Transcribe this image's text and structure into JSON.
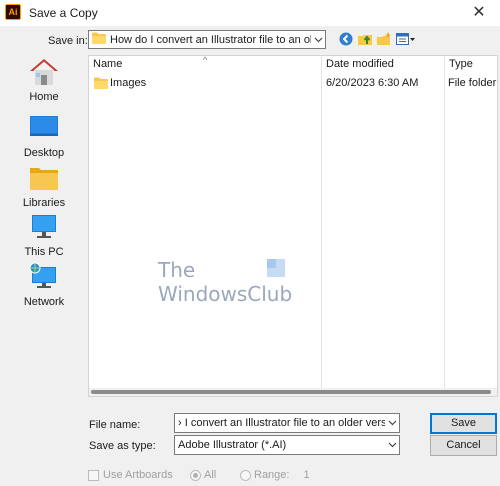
{
  "window": {
    "app_icon_text": "Ai",
    "title": "Save a Copy",
    "close_glyph": "✕"
  },
  "save_in": {
    "label": "Save in:",
    "value": "How do I convert an Illustrator file to an older version",
    "icon": "folder-icon"
  },
  "toolbar": {
    "icons": [
      "back-icon",
      "up-folder-icon",
      "new-folder-icon",
      "view-menu-icon"
    ]
  },
  "places": [
    {
      "label": "Home",
      "icon": "home-icon"
    },
    {
      "label": "Desktop",
      "icon": "desktop-icon"
    },
    {
      "label": "Libraries",
      "icon": "libraries-icon"
    },
    {
      "label": "This PC",
      "icon": "this-pc-icon"
    },
    {
      "label": "Network",
      "icon": "network-icon"
    }
  ],
  "file_list": {
    "columns": [
      "Name",
      "Date modified",
      "Type"
    ],
    "sort_indicator": "^",
    "rows": [
      {
        "name": "Images",
        "date": "6/20/2023 6:30 AM",
        "type": "File folder",
        "icon": "folder-icon"
      }
    ]
  },
  "watermark": {
    "line1": "The",
    "line2": "WindowsClub"
  },
  "form": {
    "file_name_label": "File name:",
    "file_name_value": "› I convert an Illustrator file to an older version Copy",
    "save_type_label": "Save as type:",
    "save_type_value": "Adobe Illustrator (*.AI)",
    "save_button": "Save",
    "cancel_button": "Cancel"
  },
  "options": {
    "use_artboards": "Use Artboards",
    "all": "All",
    "range": "Range:",
    "range_value": "1"
  },
  "colors": {
    "accent": "#0078d7",
    "folder": "#f8c74f",
    "window_bg": "#f0f0f0"
  }
}
